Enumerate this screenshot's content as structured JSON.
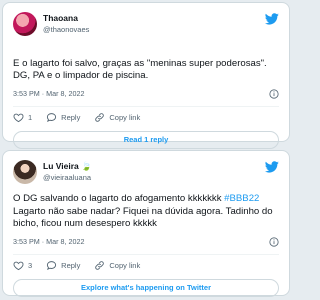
{
  "tweets": [
    {
      "display_name": "Thaoana",
      "handle": "@thaonovaes",
      "text_parts": [
        {
          "text": "E o lagarto foi salvo, graças as \"meninas super poderosas\".\nDG, PA e o limpador de piscina.",
          "hashtag": false
        }
      ],
      "timestamp": "3:53 PM · Mar 8, 2022",
      "likes": "1",
      "reply_label": "Reply",
      "copy_label": "Copy link",
      "cta_label": "Read 1 reply"
    },
    {
      "display_name": "Lu Vieira 🍃",
      "handle": "@vieiraaluana",
      "text_parts": [
        {
          "text": "O DG salvando o lagarto do afogamento kkkkkkk ",
          "hashtag": false
        },
        {
          "text": "#BBB22",
          "hashtag": true
        },
        {
          "text": "\nLagarto não sabe nadar? Fiquei na dúvida agora. Tadinho do bicho, ficou num desespero kkkkk",
          "hashtag": false
        }
      ],
      "timestamp": "3:53 PM · Mar 8, 2022",
      "likes": "3",
      "reply_label": "Reply",
      "copy_label": "Copy link",
      "cta_label": "Explore what's happening on Twitter"
    }
  ],
  "icons": {
    "brand": "twitter-bird-icon",
    "like": "heart-icon",
    "reply": "reply-bubble-icon",
    "copy": "link-icon",
    "info": "info-icon"
  },
  "colors": {
    "accent": "#1d9bf0",
    "text": "#0f1419",
    "muted": "#536471",
    "border": "#cfd9de",
    "background": "#e6ecf0"
  }
}
